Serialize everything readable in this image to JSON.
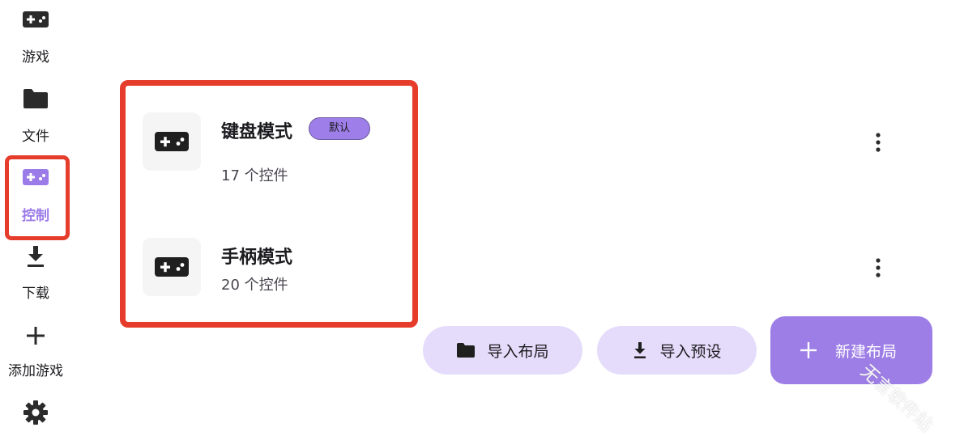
{
  "sidebar": {
    "items": [
      {
        "label": "游戏",
        "icon": "gamepad-icon"
      },
      {
        "label": "文件",
        "icon": "folder-icon"
      },
      {
        "label": "控制",
        "icon": "gamepad-icon",
        "active": true
      },
      {
        "label": "下载",
        "icon": "download-icon"
      },
      {
        "label": "添加游戏",
        "icon": "plus-icon"
      },
      {
        "label": "",
        "icon": "gear-icon"
      }
    ]
  },
  "layouts": [
    {
      "name": "键盘模式",
      "badge": "默认",
      "count": "17 个控件",
      "icon": "gamepad-icon"
    },
    {
      "name": "手柄模式",
      "count": "20 个控件",
      "icon": "gamepad-icon"
    }
  ],
  "actions": {
    "import_layout": "导入布局",
    "import_preset": "导入预设",
    "new_layout": "新建布局"
  },
  "watermark": "无言软件站",
  "colors": {
    "accent": "#9d7de6",
    "pill_bg": "#e5dcfb",
    "highlight": "#e63c2b"
  }
}
